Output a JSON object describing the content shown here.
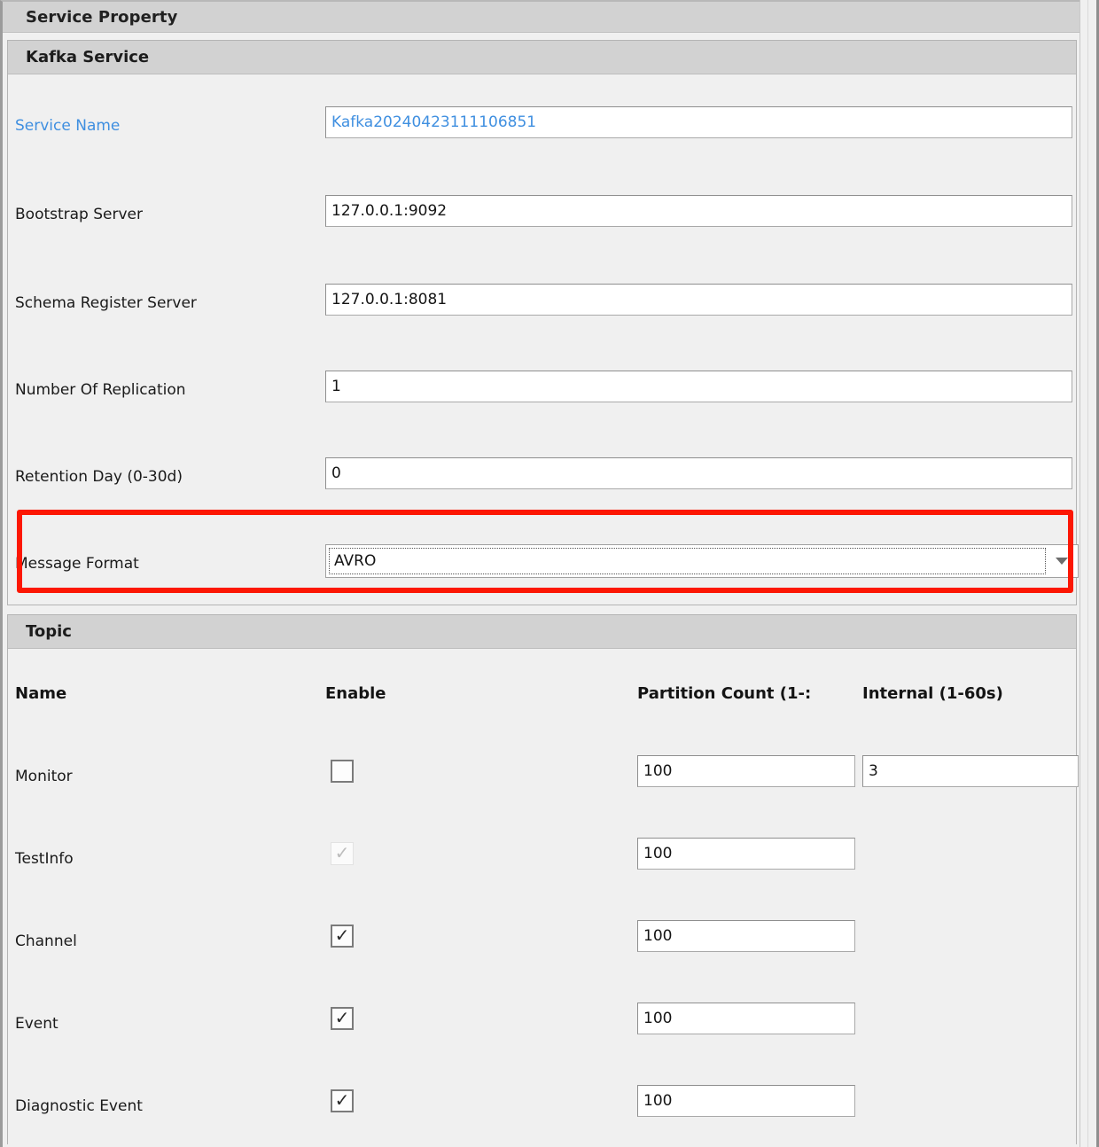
{
  "window": {
    "title": "Service Property"
  },
  "kafka_section": {
    "header": "Kafka Service",
    "fields": [
      {
        "label": "Service Name",
        "value": "Kafka20240423111106851",
        "type": "text",
        "link": true
      },
      {
        "label": "Bootstrap Server",
        "value": "127.0.0.1:9092",
        "type": "text",
        "link": false
      },
      {
        "label": "Schema Register Server",
        "value": "127.0.0.1:8081",
        "type": "text",
        "link": false
      },
      {
        "label": "Number Of Replication",
        "value": "1",
        "type": "text",
        "link": false
      },
      {
        "label": "Retention Day (0-30d)",
        "value": "0",
        "type": "text",
        "link": false
      },
      {
        "label": "Message Format",
        "value": "AVRO",
        "type": "combo",
        "link": false
      }
    ],
    "message_format": {
      "label": "Message Format",
      "selected": "AVRO",
      "focused": true,
      "arrow_icon": "chevron-down-icon"
    }
  },
  "topic_section": {
    "header": "Topic",
    "columns": {
      "name": "Name",
      "enable": "Enable",
      "partition_count": "Partition Count (1-:",
      "internal": "Internal (1-60s)"
    },
    "rows": [
      {
        "name": "Monitor",
        "enabled": false,
        "enable_disabled": false,
        "partition_count": "100",
        "internal": "3"
      },
      {
        "name": "TestInfo",
        "enabled": true,
        "enable_disabled": true,
        "partition_count": "100",
        "internal": null
      },
      {
        "name": "Channel",
        "enabled": true,
        "enable_disabled": false,
        "partition_count": "100",
        "internal": null
      },
      {
        "name": "Event",
        "enabled": true,
        "enable_disabled": false,
        "partition_count": "100",
        "internal": null
      },
      {
        "name": "Diagnostic Event",
        "enabled": true,
        "enable_disabled": false,
        "partition_count": "100",
        "internal": null
      }
    ]
  },
  "highlight": {
    "color": "#fc1703",
    "target": "message-format-row"
  },
  "colors": {
    "header_bar": "#d2d2d2",
    "panel_bg": "#f0f0f0",
    "link_text": "#3f8fe0",
    "field_border": "#a9a9a9",
    "highlight": "#fc1703"
  }
}
